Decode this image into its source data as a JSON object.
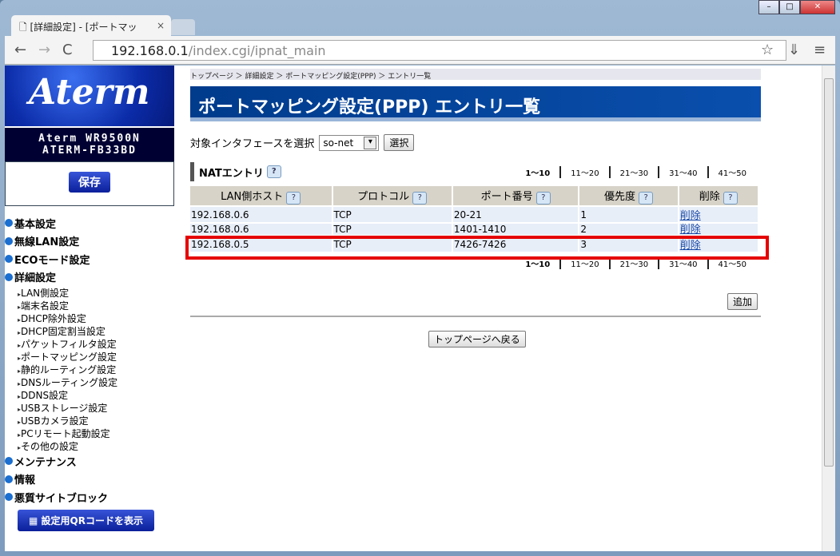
{
  "browser": {
    "tab_title": "[詳細設定] - [ポートマッ",
    "url_host": "192.168.0.1",
    "url_path": "/index.cgi/ipnat_main"
  },
  "sidebar": {
    "logo": "Aterm",
    "model": "Aterm WR9500N",
    "ssid": "ATERM-FB33BD",
    "save": "保存",
    "menu": [
      {
        "label": "基本設定"
      },
      {
        "label": "無線LAN設定"
      },
      {
        "label": "ECOモード設定"
      },
      {
        "label": "詳細設定"
      }
    ],
    "submenu": [
      "LAN側設定",
      "端末名設定",
      "DHCP除外設定",
      "DHCP固定割当設定",
      "パケットフィルタ設定",
      "ポートマッピング設定",
      "静的ルーティング設定",
      "DNSルーティング設定",
      "DDNS設定",
      "USBストレージ設定",
      "USBカメラ設定",
      "PCリモート起動設定",
      "その他の設定"
    ],
    "menu2": [
      "メンテナンス",
      "情報",
      "悪質サイトブロック"
    ],
    "qr": "設定用QRコードを表示"
  },
  "main": {
    "breadcrumb": "トップページ ＞ 詳細設定 ＞ ポートマッピング設定(PPP) ＞ エントリ一覧",
    "title": "ポートマッピング設定(PPP) エントリ一覧",
    "if_label": "対象インタフェースを選択",
    "if_value": "so-net",
    "select_btn": "選択",
    "nat_title": "NATエントリ",
    "help": "?",
    "pages": [
      "1〜10",
      "11〜20",
      "21〜30",
      "31〜40",
      "41〜50"
    ],
    "columns": [
      "LAN側ホスト",
      "プロトコル",
      "ポート番号",
      "優先度",
      "削除"
    ],
    "rows": [
      [
        "192.168.0.6",
        "TCP",
        "20-21",
        "1",
        "削除"
      ],
      [
        "192.168.0.6",
        "TCP",
        "1401-1410",
        "2",
        "削除"
      ],
      [
        "192.168.0.5",
        "TCP",
        "7426-7426",
        "3",
        "削除"
      ]
    ],
    "add": "追加",
    "back": "トップページへ戻る"
  }
}
